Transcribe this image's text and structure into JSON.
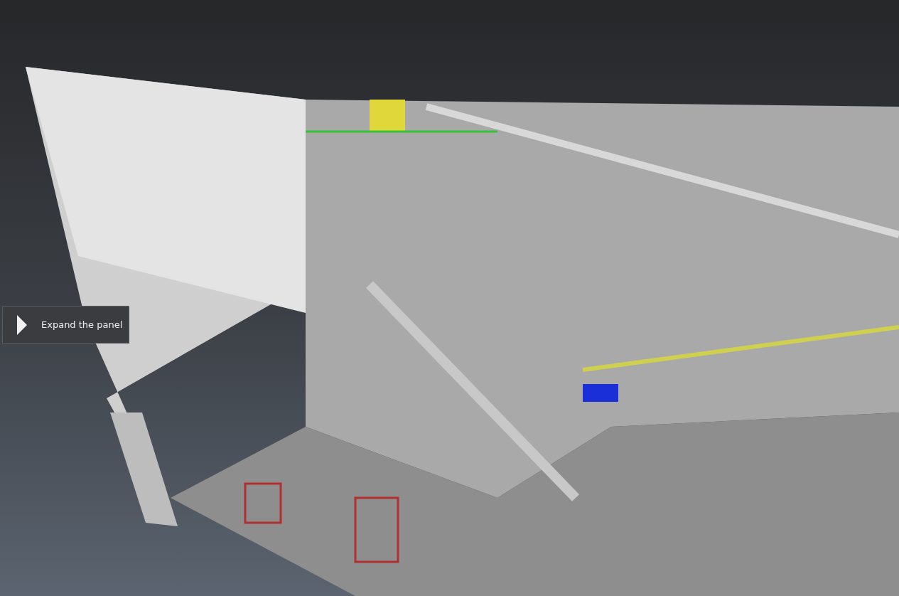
{
  "expand_panel": {
    "label": "Expand the panel"
  }
}
